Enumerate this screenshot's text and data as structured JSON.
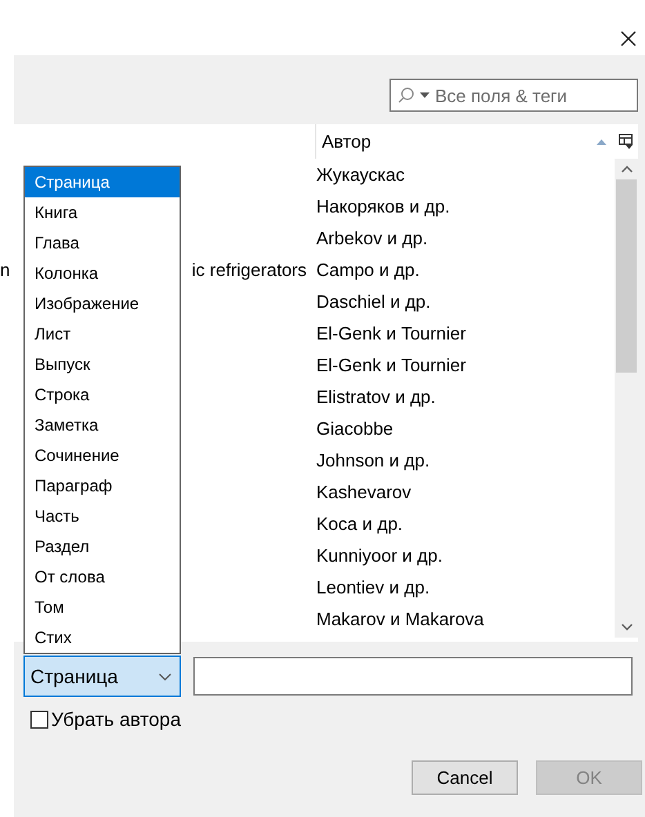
{
  "search": {
    "placeholder": "Все поля & теги"
  },
  "table": {
    "columns": [
      {
        "label": "Автор",
        "sort_ascending": true
      }
    ],
    "rows": [
      {
        "author": "Жукаускас"
      },
      {
        "author": "Накоряков и др."
      },
      {
        "author": "Arbekov и др."
      },
      {
        "author": "Campo и др.",
        "column_1": [
          "n",
          "ic refrigerators"
        ]
      },
      {
        "author": "Daschiel и др."
      },
      {
        "author": "El-Genk и Tournier"
      },
      {
        "author": "El-Genk и Tournier"
      },
      {
        "author": "Elistratov и др."
      },
      {
        "author": "Giacobbe"
      },
      {
        "author": "Johnson и др."
      },
      {
        "author": "Kashevarov"
      },
      {
        "author": "Koca и др."
      },
      {
        "author": "Kunniyoor и др."
      },
      {
        "author": "Leontiev и др."
      },
      {
        "author": "Makarov и Makarova"
      }
    ]
  },
  "locator": {
    "value": "Страница",
    "open": true,
    "options": [
      {
        "label": "Страница",
        "selected": true
      },
      {
        "label": "Книга",
        "selected": false
      },
      {
        "label": "Глава",
        "selected": false
      },
      {
        "label": "Колонка",
        "selected": false
      },
      {
        "label": "Изображение",
        "selected": false
      },
      {
        "label": "Лист",
        "selected": false
      },
      {
        "label": "Выпуск",
        "selected": false
      },
      {
        "label": "Строка",
        "selected": false
      },
      {
        "label": "Заметка",
        "selected": false
      },
      {
        "label": "Сочинение",
        "selected": false
      },
      {
        "label": "Параграф",
        "selected": false
      },
      {
        "label": "Часть",
        "selected": false
      },
      {
        "label": "Раздел",
        "selected": false
      },
      {
        "label": "От слова",
        "selected": false
      },
      {
        "label": "Том",
        "selected": false
      },
      {
        "label": "Стих",
        "selected": false
      }
    ]
  },
  "checkbox": {
    "label": "Убрать автора",
    "checked": false
  },
  "buttons": [
    {
      "label": "Cancel",
      "disabled": false
    },
    {
      "label": "OK",
      "disabled": true
    }
  ]
}
